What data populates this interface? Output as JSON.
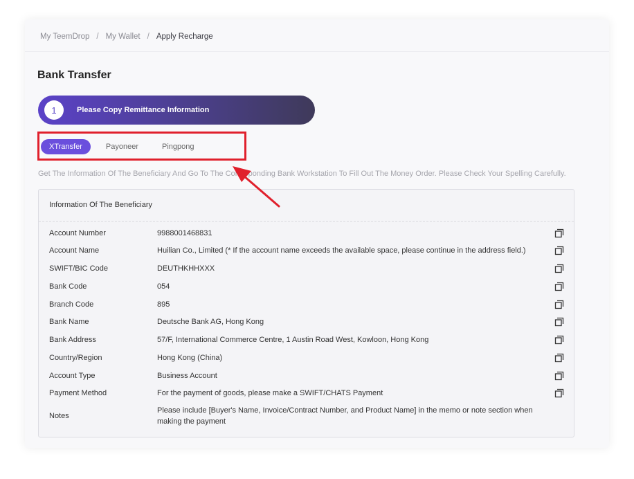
{
  "breadcrumb": {
    "items": [
      "My TeemDrop",
      "My Wallet",
      "Apply Recharge"
    ],
    "separator": "/"
  },
  "page_title": "Bank Transfer",
  "step": {
    "number": "1",
    "label": "Please Copy Remittance Information"
  },
  "tabs": [
    {
      "label": "XTransfer",
      "active": true
    },
    {
      "label": "Payoneer",
      "active": false
    },
    {
      "label": "Pingpong",
      "active": false
    }
  ],
  "hint": "Get The Information Of The Beneficiary And Go To The Corresponding Bank Workstation To Fill Out The Money Order. Please Check Your Spelling Carefully.",
  "panel": {
    "title": "Information Of The Beneficiary",
    "rows": [
      {
        "label": "Account Number",
        "value": "9988001468831",
        "copy": true
      },
      {
        "label": "Account Name",
        "value": "Huilian Co., Limited (* If the account name exceeds the available space, please continue in the address field.)",
        "copy": true
      },
      {
        "label": "SWIFT/BIC Code",
        "value": "DEUTHKHHXXX",
        "copy": true
      },
      {
        "label": "Bank Code",
        "value": "054",
        "copy": true
      },
      {
        "label": "Branch Code",
        "value": "895",
        "copy": true
      },
      {
        "label": "Bank Name",
        "value": "Deutsche Bank AG, Hong Kong",
        "copy": true
      },
      {
        "label": "Bank Address",
        "value": "57/F, International Commerce Centre, 1 Austin Road West, Kowloon, Hong Kong",
        "copy": true
      },
      {
        "label": "Country/Region",
        "value": "Hong Kong (China)",
        "copy": true
      },
      {
        "label": "Account Type",
        "value": "Business Account",
        "copy": true
      },
      {
        "label": "Payment Method",
        "value": "For the payment of goods, please make a SWIFT/CHATS Payment",
        "copy": true
      },
      {
        "label": "Notes",
        "value": "Please include [Buyer's Name, Invoice/Contract Number, and Product Name] in the memo or note section when making the payment",
        "copy": false
      }
    ]
  },
  "colors": {
    "accent": "#6a4fdd",
    "highlight": "#e0202c",
    "banner_start": "#5b42c8",
    "banner_end": "#3f3a5a"
  },
  "icons": {
    "copy": "copy-icon",
    "annotation": "red-arrow-annotation"
  }
}
